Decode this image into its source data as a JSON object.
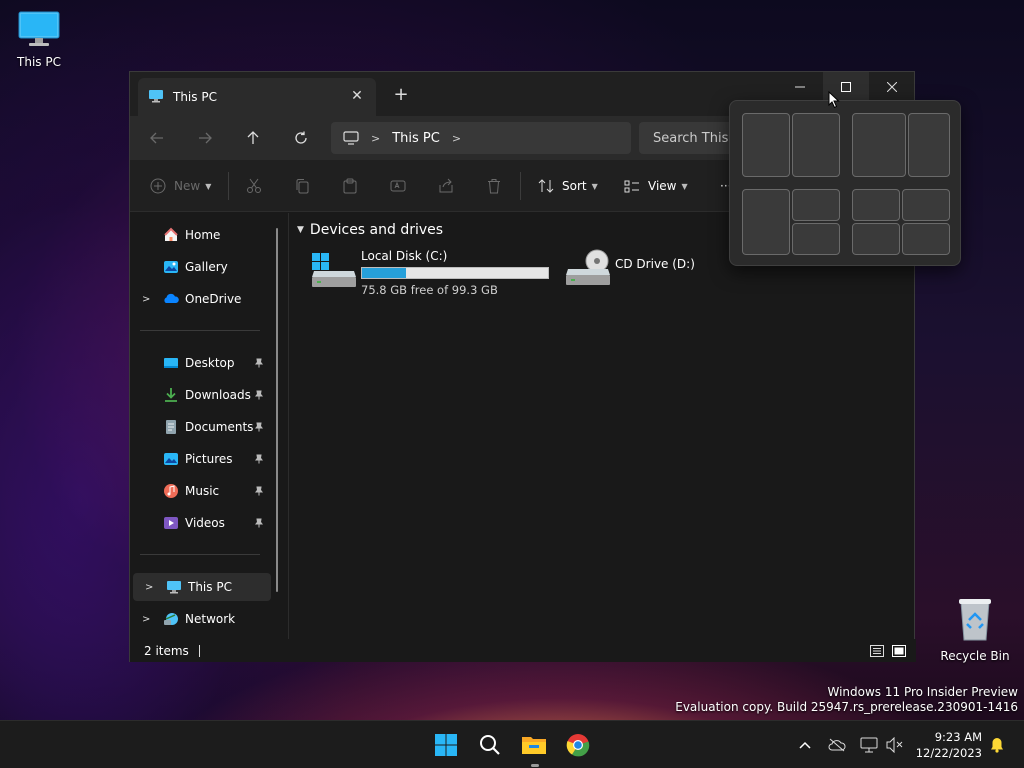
{
  "desktop": {
    "icons": [
      {
        "label": "This PC",
        "icon": "this-pc-icon"
      },
      {
        "label": "Recycle Bin",
        "icon": "recycle-bin-icon"
      }
    ],
    "watermark": {
      "line1": "Windows 11 Pro Insider Preview",
      "line2": "Evaluation copy. Build 25947.rs_prerelease.230901-1416"
    }
  },
  "explorer": {
    "tab": {
      "title": "This PC",
      "icon": "this-pc-icon",
      "close": "✕"
    },
    "new_tab": "+",
    "window_controls": {
      "minimize": "—",
      "maximize": "☐",
      "close": "✕"
    },
    "nav": {
      "back": "←",
      "forward": "→",
      "up": "↑",
      "refresh": "⟳",
      "breadcrumb": [
        "This PC"
      ],
      "search_placeholder": "Search This PC"
    },
    "command_bar": {
      "new_label": "New",
      "sort_label": "Sort",
      "view_label": "View",
      "more": "···"
    },
    "sidebar": {
      "quick": [
        {
          "label": "Home",
          "icon": "home-icon"
        },
        {
          "label": "Gallery",
          "icon": "gallery-icon"
        },
        {
          "label": "OneDrive",
          "icon": "onedrive-icon",
          "expandable": true
        }
      ],
      "pinned": [
        {
          "label": "Desktop",
          "icon": "desktop-folder-icon"
        },
        {
          "label": "Downloads",
          "icon": "downloads-icon"
        },
        {
          "label": "Documents",
          "icon": "documents-icon"
        },
        {
          "label": "Pictures",
          "icon": "pictures-icon"
        },
        {
          "label": "Music",
          "icon": "music-icon"
        },
        {
          "label": "Videos",
          "icon": "videos-icon"
        }
      ],
      "locations": [
        {
          "label": "This PC",
          "icon": "this-pc-icon",
          "selected": true
        },
        {
          "label": "Network",
          "icon": "network-icon"
        }
      ]
    },
    "content": {
      "group_header": "Devices and drives",
      "drives": [
        {
          "name": "Local Disk (C:)",
          "free_text": "75.8 GB free of 99.3 GB",
          "used_fraction": 0.237,
          "icon": "local-disk-icon"
        },
        {
          "name": "CD Drive (D:)",
          "icon": "cd-drive-icon"
        }
      ]
    },
    "status": {
      "items": "2 items"
    },
    "colors": {
      "bar_fill": "#26a0da",
      "bg": "#191919"
    }
  },
  "snap_layouts": {
    "layouts": [
      "two-equal",
      "two-wide-left",
      "three-columns-split",
      "four-grid"
    ]
  },
  "taskbar": {
    "icons": [
      "start-icon",
      "search-icon",
      "file-explorer-icon",
      "chrome-icon"
    ],
    "tray": [
      "chevron-up-icon",
      "cloud-off-icon",
      "network-icon",
      "volume-mute-icon",
      "notification-bell-icon"
    ],
    "time": "9:23 AM",
    "date": "12/22/2023"
  }
}
